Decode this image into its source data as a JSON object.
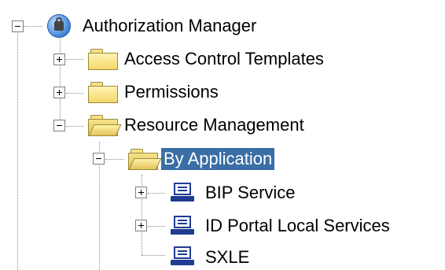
{
  "tree": {
    "root": {
      "label": "Authorization Manager",
      "icon": "authorization-manager-icon"
    },
    "children": [
      {
        "label": "Access Control Templates",
        "icon": "folder-icon",
        "expander": "plus"
      },
      {
        "label": "Permissions",
        "icon": "folder-icon",
        "expander": "plus"
      },
      {
        "label": "Resource Management",
        "icon": "folder-open-icon",
        "expander": "minus",
        "children": [
          {
            "label": "By Application",
            "icon": "folder-open-icon",
            "expander": "minus",
            "selected": true,
            "children": [
              {
                "label": "BIP Service",
                "icon": "computer-icon",
                "expander": "plus"
              },
              {
                "label": "ID Portal Local Services",
                "icon": "computer-icon",
                "expander": "plus"
              },
              {
                "label": "SXLE",
                "icon": "computer-icon"
              }
            ]
          }
        ]
      }
    ]
  },
  "colors": {
    "selection": "#3a6ea5",
    "selection_text": "#ffffff",
    "tree_lines": "#8a8a8a"
  }
}
